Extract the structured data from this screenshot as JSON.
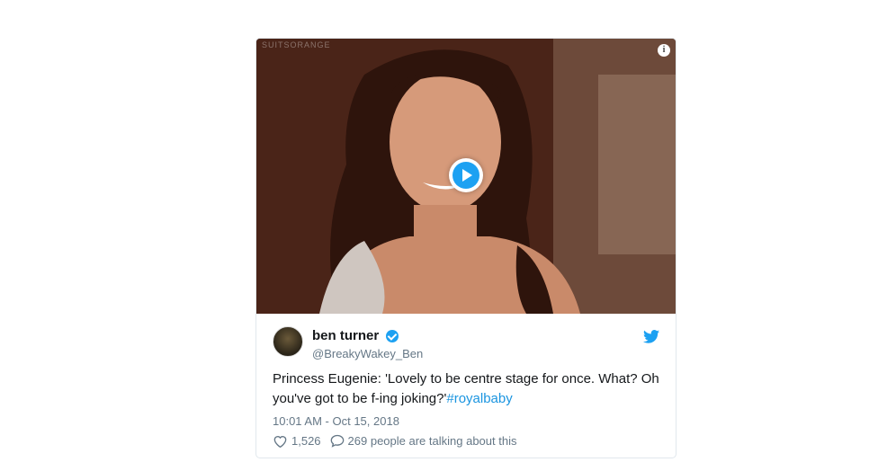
{
  "media": {
    "watermark": "SUITSORANGE",
    "info_icon": "i"
  },
  "tweet": {
    "user_name": "ben turner",
    "user_handle": "@BreakyWakey_Ben",
    "text_main": "Princess Eugenie: 'Lovely to be centre stage for once. What? Oh you've got to be f-ing joking?'",
    "hashtag": "#royalbaby",
    "timestamp": "10:01 AM - Oct 15, 2018",
    "likes": "1,526",
    "comments": "269 people are talking about this"
  },
  "colors": {
    "accent": "#1da1f2",
    "link": "#1b95e0",
    "muted": "#657786"
  }
}
